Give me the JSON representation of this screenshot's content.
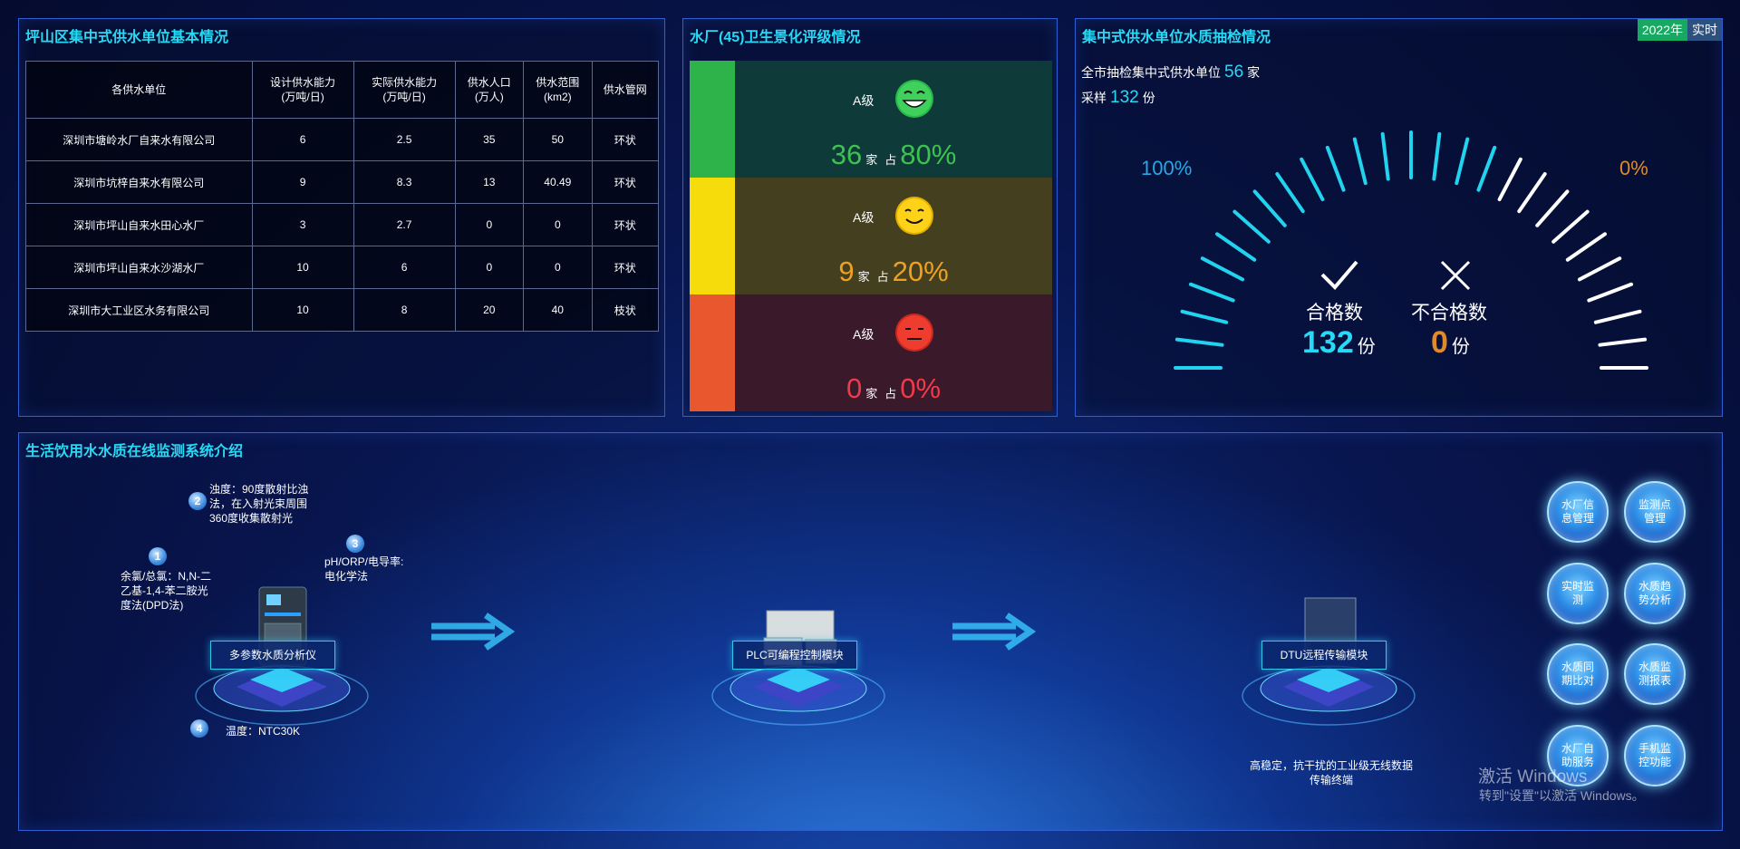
{
  "panel1": {
    "title": "坪山区集中式供水单位基本情况",
    "headers": [
      "各供水单位",
      "设计供水能力\n(万吨/日)",
      "实际供水能力\n(万吨/日)",
      "供水人口\n(万人)",
      "供水范围\n(km2)",
      "供水管网"
    ],
    "rows": [
      [
        "深圳市塘岭水厂自来水有限公司",
        "6",
        "2.5",
        "35",
        "50",
        "环状"
      ],
      [
        "深圳市坑梓自来水有限公司",
        "9",
        "8.3",
        "13",
        "40.49",
        "环状"
      ],
      [
        "深圳市坪山自来水田心水厂",
        "3",
        "2.7",
        "0",
        "0",
        "环状"
      ],
      [
        "深圳市坪山自来水沙湖水厂",
        "10",
        "6",
        "0",
        "0",
        "环状"
      ],
      [
        "深圳市大工业区水务有限公司",
        "10",
        "8",
        "20",
        "40",
        "枝状"
      ]
    ]
  },
  "panel2": {
    "title": "水厂(45)卫生景化评级情况",
    "ratings": [
      {
        "grade": "A级",
        "count": "36",
        "unit": "家",
        "of": "占",
        "percent": "80%",
        "color": "#2db34a",
        "bg": "#0e3a3a",
        "text_color": "#3ec24f",
        "face": "grin"
      },
      {
        "grade": "A级",
        "count": "9",
        "unit": "家",
        "of": "占",
        "percent": "20%",
        "color": "#f7dc0c",
        "bg": "#44401f",
        "text_color": "#f0a020",
        "face": "smile"
      },
      {
        "grade": "A级",
        "count": "0",
        "unit": "家",
        "of": "占",
        "percent": "0%",
        "color": "#e9572f",
        "bg": "#3a1a2a",
        "text_color": "#f03a4a",
        "face": "neutral"
      }
    ]
  },
  "panel3": {
    "title": "集中式供水单位水质抽检情况",
    "year_tab": "2022年",
    "realtime_tab": "实时",
    "line1_prefix": "全市抽检集中式供水单位",
    "line1_value": "56",
    "line1_suffix": "家",
    "line2_prefix": "采样",
    "line2_value": "132",
    "line2_suffix": "份",
    "pass_pct": "100%",
    "fail_pct": "0%",
    "pass_label": "合格数",
    "fail_label": "不合格数",
    "pass_value": "132",
    "fail_value": "0",
    "unit": "份",
    "pass_ratio": 1.0,
    "colors": {
      "pass": "#22d3f0",
      "fail": "#e08a2a"
    }
  },
  "panel4": {
    "title": "生活饮用水水质在线监测系统介绍",
    "devices": [
      {
        "label": "多参数水质分析仪"
      },
      {
        "label": "PLC可编程控制模块"
      },
      {
        "label": "DTU远程传输模块"
      }
    ],
    "notes": {
      "n1": "余氯/总氯：N,N-二乙基-1,4-苯二胺光度法(DPD法)",
      "n2": "浊度：90度散射比浊法，在入射光束周围360度收集散射光",
      "n3": "pH/ORP/电导率:电化学法",
      "n4": "温度：NTC30K",
      "dtu": "高稳定，抗干扰的工业级无线数据传输终端"
    },
    "badges": [
      "1",
      "2",
      "3",
      "4"
    ],
    "buttons": [
      "水厂信息管理",
      "监测点管理",
      "实时监测",
      "水质趋势分析",
      "水质同期比对",
      "水质监测报表",
      "水厂自助服务",
      "手机监控功能"
    ],
    "watermark_line1": "激活 Windows",
    "watermark_line2": "转到\"设置\"以激活 Windows。"
  }
}
